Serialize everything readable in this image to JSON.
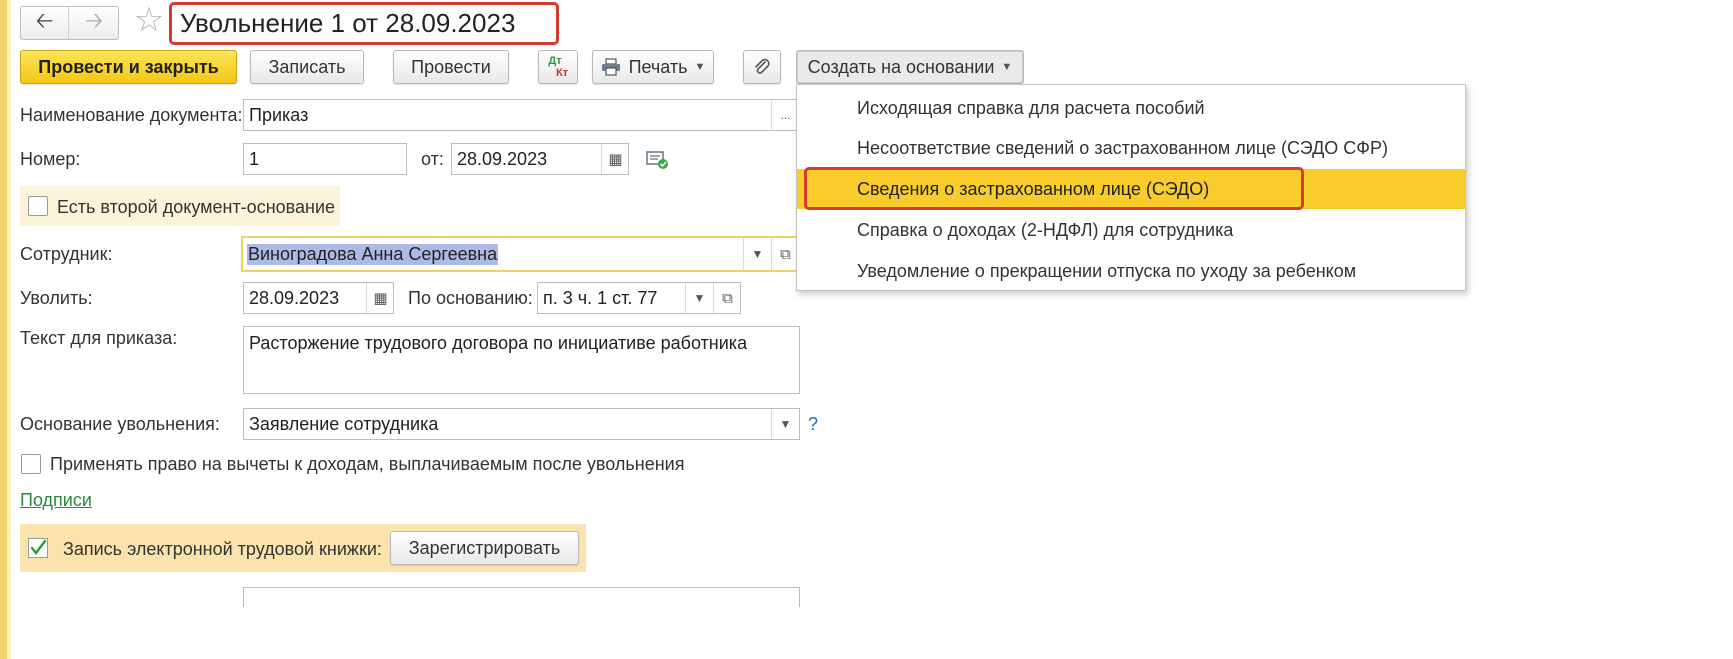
{
  "document": {
    "title": "Увольнение 1 от 28.09.2023"
  },
  "toolbar": {
    "post_and_close": "Провести и закрыть",
    "save": "Записать",
    "post": "Провести",
    "dtkt_top": "Дт",
    "dtkt_bottom": "Кт",
    "print": "Печать",
    "create_based_on": "Создать на основании"
  },
  "create_menu": {
    "items": [
      "Исходящая справка для расчета пособий",
      "Несоответствие сведений о застрахованном лице (СЭДО СФР)",
      "Сведения о застрахованном лице (СЭДО)",
      "Справка о доходах (2-НДФЛ) для сотрудника",
      "Уведомление о прекращении отпуска по уходу за ребенком"
    ],
    "selected_index": 2
  },
  "form": {
    "doc_name_label": "Наименование документа:",
    "doc_name_value": "Приказ",
    "number_label": "Номер:",
    "number_value": "1",
    "date_label": "от:",
    "date_value": "28.09.2023",
    "second_basis_label": "Есть второй документ-основание",
    "employee_label": "Сотрудник:",
    "employee_value": "Виноградова Анна Сергеевна",
    "dismiss_label": "Уволить:",
    "dismiss_date": "28.09.2023",
    "basis_label": "По основанию:",
    "basis_value": "п. 3 ч. 1 ст. 77",
    "order_text_label": "Текст для приказа:",
    "order_text_value": "Расторжение трудового договора по инициативе работника",
    "reason_label": "Основание увольнения:",
    "reason_value": "Заявление сотрудника",
    "help_mark": "?",
    "deductions_label": "Применять право на вычеты к доходам, выплачиваемым после увольнения",
    "signatures_link": "Подписи",
    "etk_label": "Запись электронной трудовой книжки:",
    "register_button": "Зарегистрировать",
    "ellipsis": "..."
  },
  "colors": {
    "primary_button": "#f3c814",
    "menu_highlight": "#f8cd2b",
    "annotation_red": "#d63a32",
    "link_green": "#2a8a3d"
  }
}
